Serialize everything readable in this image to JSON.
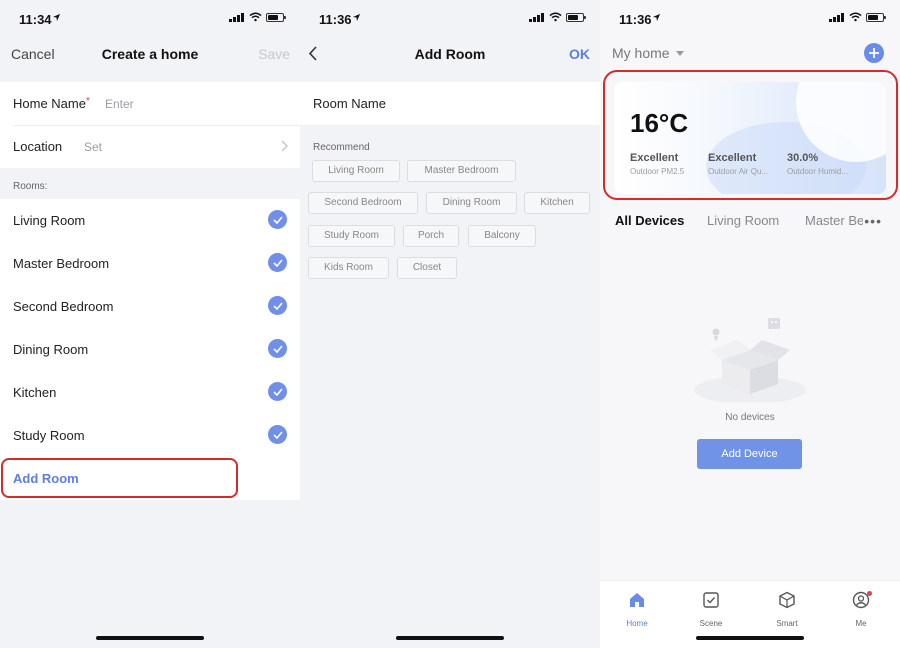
{
  "panel1": {
    "time": "11:34",
    "nav": {
      "cancel": "Cancel",
      "title": "Create a home",
      "save": "Save"
    },
    "home_name": {
      "label": "Home Name",
      "required_mark": "*",
      "placeholder": "Enter"
    },
    "location": {
      "label": "Location",
      "value": "Set"
    },
    "rooms_header": "Rooms:",
    "rooms": [
      {
        "label": "Living Room",
        "checked": true
      },
      {
        "label": "Master Bedroom",
        "checked": true
      },
      {
        "label": "Second Bedroom",
        "checked": true
      },
      {
        "label": "Dining Room",
        "checked": true
      },
      {
        "label": "Kitchen",
        "checked": true
      },
      {
        "label": "Study Room",
        "checked": true
      }
    ],
    "add_room": "Add Room"
  },
  "panel2": {
    "time": "11:36",
    "nav": {
      "title": "Add Room",
      "ok": "OK"
    },
    "room_name_label": "Room Name",
    "recommend_label": "Recommend",
    "chips": [
      "Living Room",
      "Master Bedroom",
      "Second Bedroom",
      "Dining Room",
      "Kitchen",
      "Study Room",
      "Porch",
      "Balcony",
      "Kids Room",
      "Closet"
    ]
  },
  "panel3": {
    "time": "11:36",
    "home_name": "My home",
    "weather": {
      "temperature": "16°C",
      "metrics": [
        {
          "value": "Excellent",
          "label": "Outdoor PM2.5"
        },
        {
          "value": "Excellent",
          "label": "Outdoor Air Qu..."
        },
        {
          "value": "30.0%",
          "label": "Outdoor Humid..."
        }
      ]
    },
    "tabs": [
      "All Devices",
      "Living Room",
      "Master Be"
    ],
    "more": "•••",
    "empty_text": "No devices",
    "add_device": "Add Device",
    "tabbar": [
      {
        "label": "Home",
        "icon": "home-icon",
        "active": true
      },
      {
        "label": "Scene",
        "icon": "scene-icon",
        "active": false
      },
      {
        "label": "Smart",
        "icon": "smart-icon",
        "active": false
      },
      {
        "label": "Me",
        "icon": "profile-icon",
        "active": false
      }
    ]
  },
  "colors": {
    "accent": "#5b7fe0",
    "check": "#6f8fe8",
    "highlight": "#d62b2b"
  }
}
